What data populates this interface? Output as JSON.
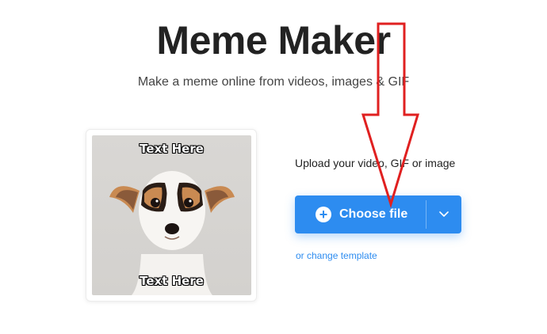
{
  "header": {
    "title": "Meme Maker",
    "subtitle": "Make a meme online from videos, images & GIF"
  },
  "meme_preview": {
    "top_text": "Text Here",
    "bottom_text": "Text Here",
    "image_subject": "dog-photo"
  },
  "upload": {
    "label": "Upload your video, GIF or image",
    "button_label": "Choose file",
    "button_icon": "plus-circle-icon",
    "dropdown_icon": "chevron-down-icon",
    "change_template_link": "or change template"
  },
  "colors": {
    "accent": "#2d8cf0",
    "title_text": "#222222",
    "annotation_arrow": "#e02020"
  }
}
